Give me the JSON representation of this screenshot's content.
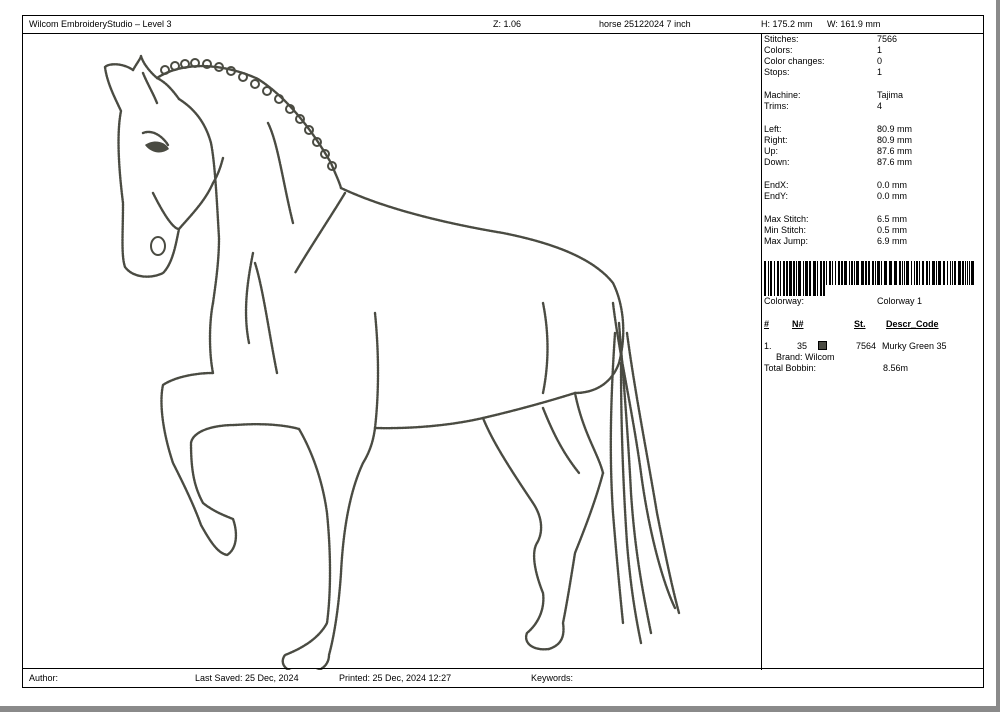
{
  "header": {
    "app_title": "Wilcom EmbroideryStudio – Level 3",
    "zoom": "Z: 1.06",
    "design_name": "horse 25122024 7 inch",
    "height": "H: 175.2 mm",
    "width": "W: 161.9 mm"
  },
  "stats": [
    {
      "label": "Stitches:",
      "value": "7566"
    },
    {
      "label": "Colors:",
      "value": "1"
    },
    {
      "label": "Color changes:",
      "value": "0"
    },
    {
      "label": "Stops:",
      "value": "1"
    },
    {
      "label": "Machine:",
      "value": "Tajima"
    },
    {
      "label": "Trims:",
      "value": "4"
    },
    {
      "label": "Left:",
      "value": "80.9 mm"
    },
    {
      "label": "Right:",
      "value": "80.9 mm"
    },
    {
      "label": "Up:",
      "value": "87.6 mm"
    },
    {
      "label": "Down:",
      "value": "87.6 mm"
    },
    {
      "label": "EndX:",
      "value": "0.0 mm"
    },
    {
      "label": "EndY:",
      "value": "0.0 mm"
    },
    {
      "label": "Max Stitch:",
      "value": "6.5 mm"
    },
    {
      "label": "Min Stitch:",
      "value": "0.5 mm"
    },
    {
      "label": "Max Jump:",
      "value": "6.9 mm"
    }
  ],
  "colorway": {
    "label": "Colorway:",
    "value": "Colorway 1"
  },
  "color_table": {
    "headers": {
      "index": "#",
      "number": "N#",
      "stitches": "St.",
      "description": "Descr_Code"
    },
    "rows": [
      {
        "index": "1.",
        "number": "35",
        "swatch_color": "#4a4b42",
        "stitches": "7564",
        "description": "Murky Green 35",
        "brand": "Brand: Wilcom"
      }
    ],
    "total_bobbin_label": "Total Bobbin:",
    "total_bobbin_value": "8.56m"
  },
  "footer": {
    "author": "Author:",
    "last_saved": "Last Saved: 25 Dec, 2024",
    "printed": "Printed: 25 Dec, 2024 12:27",
    "keywords": "Keywords:"
  },
  "colors": {
    "thread": "#4a4b42",
    "background": "#ababab"
  }
}
